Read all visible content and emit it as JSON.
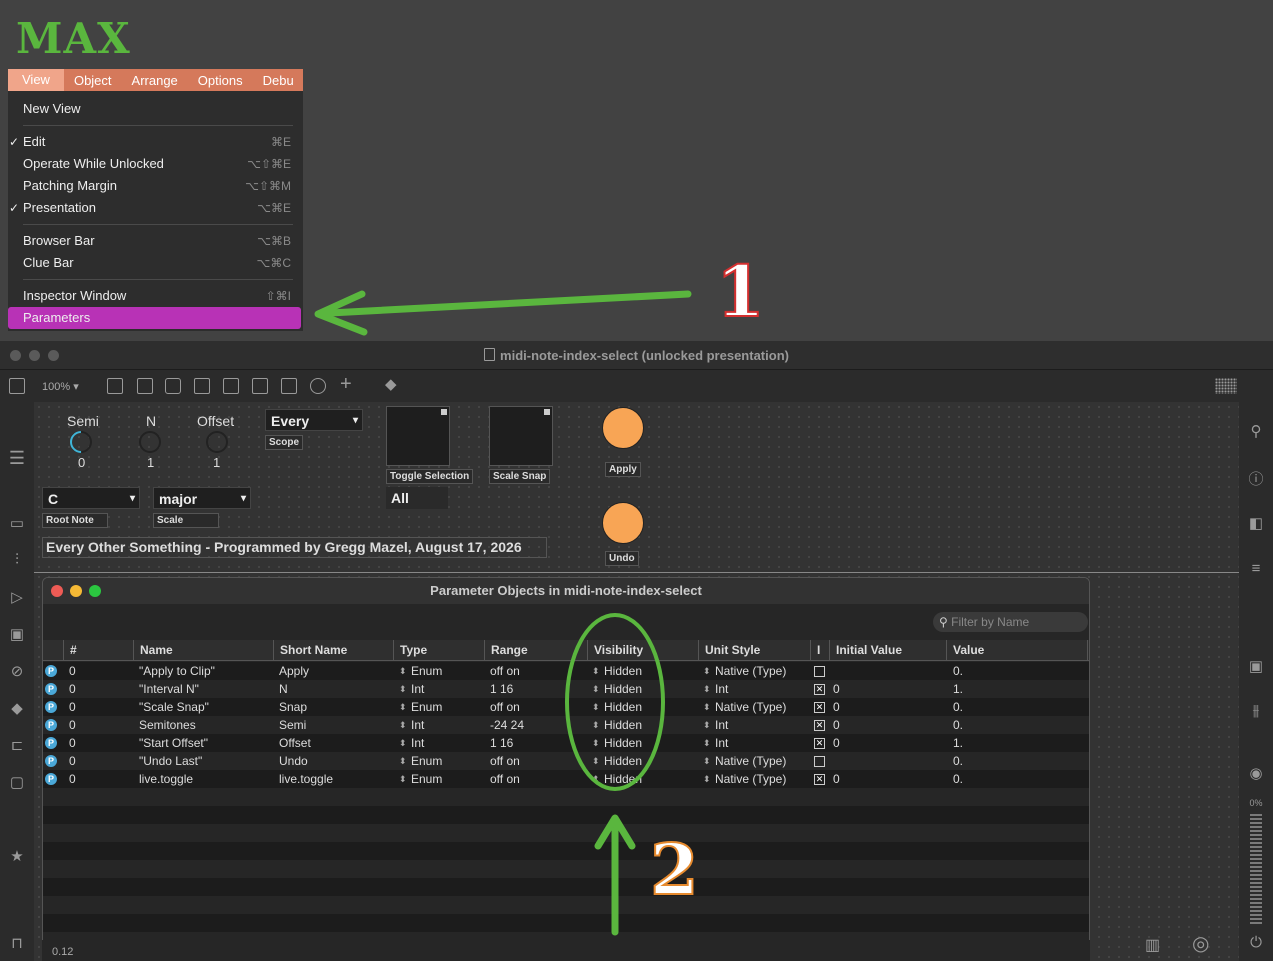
{
  "logo": "MAX",
  "menubar": [
    "View",
    "Object",
    "Arrange",
    "Options",
    "Debu"
  ],
  "menu": {
    "items": [
      {
        "label": "New View",
        "shortcut": "",
        "checked": false
      },
      {
        "label": "Edit",
        "shortcut": "⌘E",
        "checked": true
      },
      {
        "label": "Operate While Unlocked",
        "shortcut": "⌥⇧⌘E",
        "checked": false
      },
      {
        "label": "Patching Margin",
        "shortcut": "⌥⇧⌘M",
        "checked": false
      },
      {
        "label": "Presentation",
        "shortcut": "⌥⌘E",
        "checked": true
      },
      {
        "label": "Browser Bar",
        "shortcut": "⌥⌘B",
        "checked": false
      },
      {
        "label": "Clue Bar",
        "shortcut": "⌥⌘C",
        "checked": false
      },
      {
        "label": "Inspector Window",
        "shortcut": "⇧⌘I",
        "checked": false
      },
      {
        "label": "Parameters",
        "shortcut": "",
        "checked": false
      }
    ]
  },
  "annotations": {
    "one": "1",
    "two": "2",
    "arrow_color": "#5ab63e"
  },
  "window": {
    "title": "midi-note-index-select (unlocked presentation)",
    "zoom": "100%"
  },
  "patch": {
    "semi_label": "Semi",
    "semi_value": "0",
    "n_label": "N",
    "n_value": "1",
    "offset_label": "Offset",
    "offset_value": "1",
    "scope_value": "Every",
    "scope_label": "Scope",
    "toggle_selection_label": "Toggle Selection",
    "scale_snap_label": "Scale Snap",
    "apply_label": "Apply",
    "undo_label": "Undo",
    "root_value": "C",
    "root_label": "Root Note",
    "scale_value": "major",
    "scale_label": "Scale",
    "all_value": "All",
    "credit": "Every Other Something - Programmed by Gregg Mazel, August 17, 2026"
  },
  "params": {
    "title": "Parameter Objects in midi-note-index-select",
    "filter_placeholder": "Filter by Name",
    "columns": [
      "#",
      "Name",
      "Short Name",
      "Type",
      "Range",
      "Visibility",
      "Unit Style",
      "I",
      "Initial Value",
      "Value"
    ],
    "rows": [
      {
        "num": "0",
        "name": "\"Apply to Clip\"",
        "short": "Apply",
        "type": "Enum",
        "range": "off on",
        "vis": "Hidden",
        "unit": "Native (Type)",
        "init_checked": false,
        "init": "",
        "value": "0."
      },
      {
        "num": "0",
        "name": "\"Interval N\"",
        "short": "N",
        "type": "Int",
        "range": "1 16",
        "vis": "Hidden",
        "unit": "Int",
        "init_checked": true,
        "init": "0",
        "value": "1."
      },
      {
        "num": "0",
        "name": "\"Scale Snap\"",
        "short": "Snap",
        "type": "Enum",
        "range": "off on",
        "vis": "Hidden",
        "unit": "Native (Type)",
        "init_checked": true,
        "init": "0",
        "value": "0."
      },
      {
        "num": "0",
        "name": "Semitones",
        "short": "Semi",
        "type": "Int",
        "range": "-24 24",
        "vis": "Hidden",
        "unit": "Int",
        "init_checked": true,
        "init": "0",
        "value": "0."
      },
      {
        "num": "0",
        "name": "\"Start Offset\"",
        "short": "Offset",
        "type": "Int",
        "range": "1 16",
        "vis": "Hidden",
        "unit": "Int",
        "init_checked": true,
        "init": "0",
        "value": "1."
      },
      {
        "num": "0",
        "name": "\"Undo Last\"",
        "short": "Undo",
        "type": "Enum",
        "range": "off on",
        "vis": "Hidden",
        "unit": "Native (Type)",
        "init_checked": false,
        "init": "",
        "value": "0."
      },
      {
        "num": "0",
        "name": "live.toggle",
        "short": "live.toggle",
        "type": "Enum",
        "range": "off on",
        "vis": "Hidden",
        "unit": "Native (Type)",
        "init_checked": true,
        "init": "0",
        "value": "0."
      }
    ]
  },
  "status": {
    "left": "0.12",
    "cpu": "0%"
  },
  "colors": {
    "accent_green": "#5ab63e",
    "menu_highlight": "#b832b6",
    "menubar": "#d5795b",
    "button_orange": "#f8a555",
    "dial_blue": "#3fb5d8"
  }
}
